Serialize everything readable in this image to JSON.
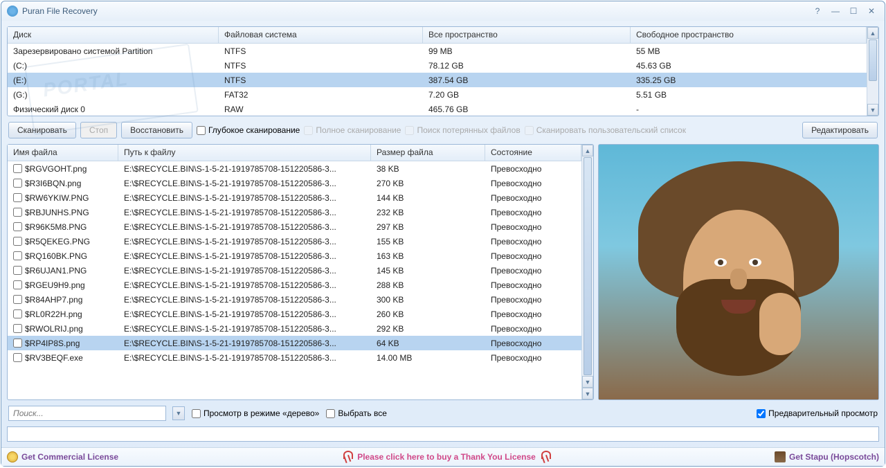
{
  "window": {
    "title": "Puran File Recovery"
  },
  "drives": {
    "headers": {
      "disk": "Диск",
      "fs": "Файловая система",
      "total": "Все пространство",
      "free": "Свободное пространство"
    },
    "rows": [
      {
        "disk": "Зарезервировано системой Partition",
        "fs": "NTFS",
        "total": "99 MB",
        "free": "55 MB"
      },
      {
        "disk": "(C:)",
        "fs": "NTFS",
        "total": "78.12 GB",
        "free": "45.63 GB"
      },
      {
        "disk": "(E:)",
        "fs": "NTFS",
        "total": "387.54 GB",
        "free": "335.25 GB"
      },
      {
        "disk": "(G:)",
        "fs": "FAT32",
        "total": "7.20 GB",
        "free": "5.51 GB"
      },
      {
        "disk": "Физический диск 0",
        "fs": "RAW",
        "total": "465.76 GB",
        "free": "-"
      }
    ],
    "selectedIndex": 2
  },
  "toolbar": {
    "scan": "Сканировать",
    "stop": "Стоп",
    "recover": "Восстановить",
    "deep_scan": "Глубокое сканирование",
    "full_scan": "Полное сканирование",
    "find_lost": "Поиск потерянных файлов",
    "scan_custom": "Сканировать пользовательский список",
    "edit": "Редактировать"
  },
  "files": {
    "headers": {
      "name": "Имя файла",
      "path": "Путь к файлу",
      "size": "Размер файла",
      "status": "Состояние"
    },
    "rows": [
      {
        "name": "$RGVGOHT.png",
        "path": "E:\\$RECYCLE.BIN\\S-1-5-21-1919785708-151220586-3...",
        "size": "38 KB",
        "status": "Превосходно"
      },
      {
        "name": "$R3I6BQN.png",
        "path": "E:\\$RECYCLE.BIN\\S-1-5-21-1919785708-151220586-3...",
        "size": "270 KB",
        "status": "Превосходно"
      },
      {
        "name": "$RW6YKIW.PNG",
        "path": "E:\\$RECYCLE.BIN\\S-1-5-21-1919785708-151220586-3...",
        "size": "144 KB",
        "status": "Превосходно"
      },
      {
        "name": "$RBJUNHS.PNG",
        "path": "E:\\$RECYCLE.BIN\\S-1-5-21-1919785708-151220586-3...",
        "size": "232 KB",
        "status": "Превосходно"
      },
      {
        "name": "$R96K5M8.PNG",
        "path": "E:\\$RECYCLE.BIN\\S-1-5-21-1919785708-151220586-3...",
        "size": "297 KB",
        "status": "Превосходно"
      },
      {
        "name": "$R5QEKEG.PNG",
        "path": "E:\\$RECYCLE.BIN\\S-1-5-21-1919785708-151220586-3...",
        "size": "155 KB",
        "status": "Превосходно"
      },
      {
        "name": "$RQ160BK.PNG",
        "path": "E:\\$RECYCLE.BIN\\S-1-5-21-1919785708-151220586-3...",
        "size": "163 KB",
        "status": "Превосходно"
      },
      {
        "name": "$R6UJAN1.PNG",
        "path": "E:\\$RECYCLE.BIN\\S-1-5-21-1919785708-151220586-3...",
        "size": "145 KB",
        "status": "Превосходно"
      },
      {
        "name": "$RGEU9H9.png",
        "path": "E:\\$RECYCLE.BIN\\S-1-5-21-1919785708-151220586-3...",
        "size": "288 KB",
        "status": "Превосходно"
      },
      {
        "name": "$R84AHP7.png",
        "path": "E:\\$RECYCLE.BIN\\S-1-5-21-1919785708-151220586-3...",
        "size": "300 KB",
        "status": "Превосходно"
      },
      {
        "name": "$RL0R22H.png",
        "path": "E:\\$RECYCLE.BIN\\S-1-5-21-1919785708-151220586-3...",
        "size": "260 KB",
        "status": "Превосходно"
      },
      {
        "name": "$RWOLRIJ.png",
        "path": "E:\\$RECYCLE.BIN\\S-1-5-21-1919785708-151220586-3...",
        "size": "292 KB",
        "status": "Превосходно"
      },
      {
        "name": "$RP4IP8S.png",
        "path": "E:\\$RECYCLE.BIN\\S-1-5-21-1919785708-151220586-3...",
        "size": "64 KB",
        "status": "Превосходно"
      },
      {
        "name": "$RV3BEQF.exe",
        "path": "E:\\$RECYCLE.BIN\\S-1-5-21-1919785708-151220586-3...",
        "size": "14.00 MB",
        "status": "Превосходно"
      }
    ],
    "selectedIndex": 12
  },
  "bottom": {
    "search_placeholder": "Поиск...",
    "tree_view": "Просмотр в режиме «дерево»",
    "select_all": "Выбрать все",
    "preview": "Предварительный просмотр"
  },
  "footer": {
    "commercial": "Get Commercial License",
    "thankyou": "Please click here to buy a Thank You License",
    "stapu": "Get Stapu (Hopscotch)"
  },
  "watermark": "PORTAL"
}
